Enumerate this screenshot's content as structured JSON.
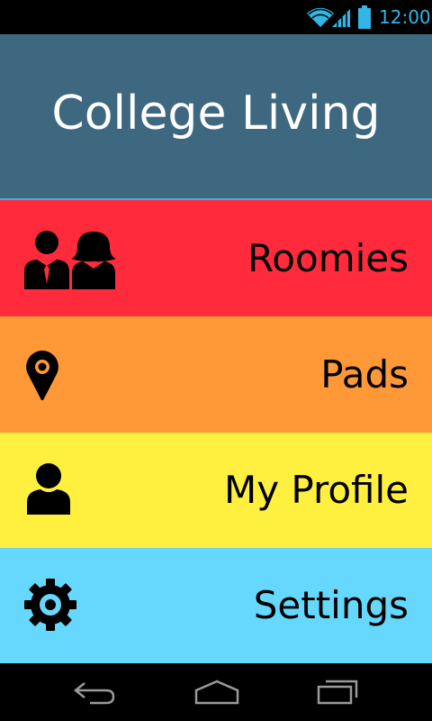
{
  "status_bar": {
    "time": "12:00",
    "icons": [
      "wifi-icon",
      "signal-icon",
      "battery-icon"
    ],
    "accent_color": "#33b5e5"
  },
  "header": {
    "title": "College Living",
    "background": "#3e6880"
  },
  "menu": {
    "items": [
      {
        "label": "Roomies",
        "icon": "roommates-icon",
        "color": "#ff2a3c"
      },
      {
        "label": "Pads",
        "icon": "location-pin-icon",
        "color": "#ff9938"
      },
      {
        "label": "My Profile",
        "icon": "user-icon",
        "color": "#ffef3e"
      },
      {
        "label": "Settings",
        "icon": "gear-icon",
        "color": "#66d8fd"
      }
    ]
  },
  "nav_bar": {
    "buttons": [
      "back-icon",
      "home-icon",
      "recent-apps-icon"
    ]
  }
}
